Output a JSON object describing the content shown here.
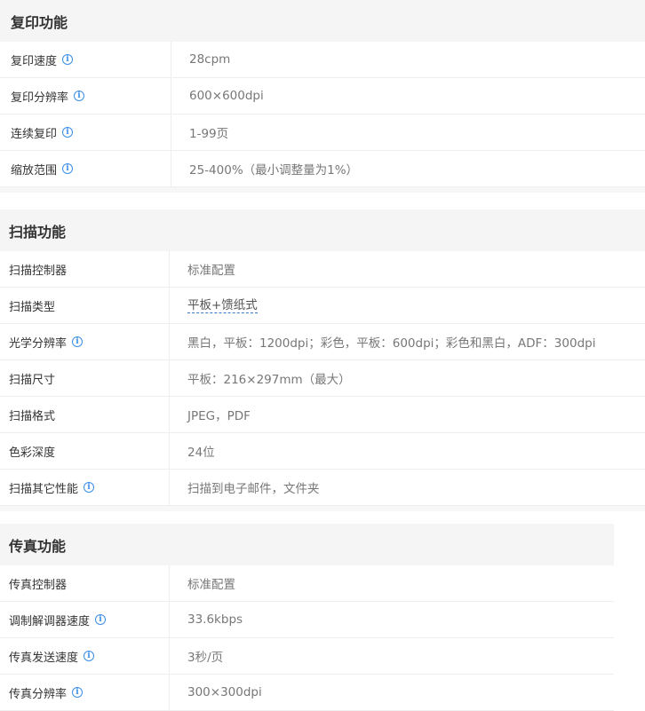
{
  "copy": {
    "title": "复印功能",
    "rows": [
      {
        "label": "复印速度",
        "value": "28cpm"
      },
      {
        "label": "复印分辨率",
        "value": "600×600dpi"
      },
      {
        "label": "连续复印",
        "value": "1-99页"
      },
      {
        "label": "缩放范围",
        "value": "25-400%（最小调整量为1%）"
      }
    ]
  },
  "scan": {
    "title": "扫描功能",
    "rows": [
      {
        "label": "扫描控制器",
        "value": "标准配置"
      },
      {
        "label": "扫描类型",
        "value": "平板+馈纸式"
      },
      {
        "label": "光学分辨率",
        "value": "黑白，平板：1200dpi；彩色，平板：600dpi；彩色和黑白，ADF：300dpi"
      },
      {
        "label": "扫描尺寸",
        "value": "平板：216×297mm（最大）"
      },
      {
        "label": "扫描格式",
        "value": "JPEG，PDF"
      },
      {
        "label": "色彩深度",
        "value": "24位"
      },
      {
        "label": "扫描其它性能",
        "value": "扫描到电子邮件，文件夹"
      }
    ]
  },
  "fax": {
    "title": "传真功能",
    "rows": [
      {
        "label": "传真控制器",
        "value": "标准配置"
      },
      {
        "label": "调制解调器速度",
        "value": "33.6kbps"
      },
      {
        "label": "传真发送速度",
        "value": "3秒/页"
      },
      {
        "label": "传真分辨率",
        "value": "300×300dpi"
      }
    ]
  },
  "icons": {
    "info": "info-icon",
    "info_glyph": "i",
    "info_color": "#3a8ee6"
  }
}
